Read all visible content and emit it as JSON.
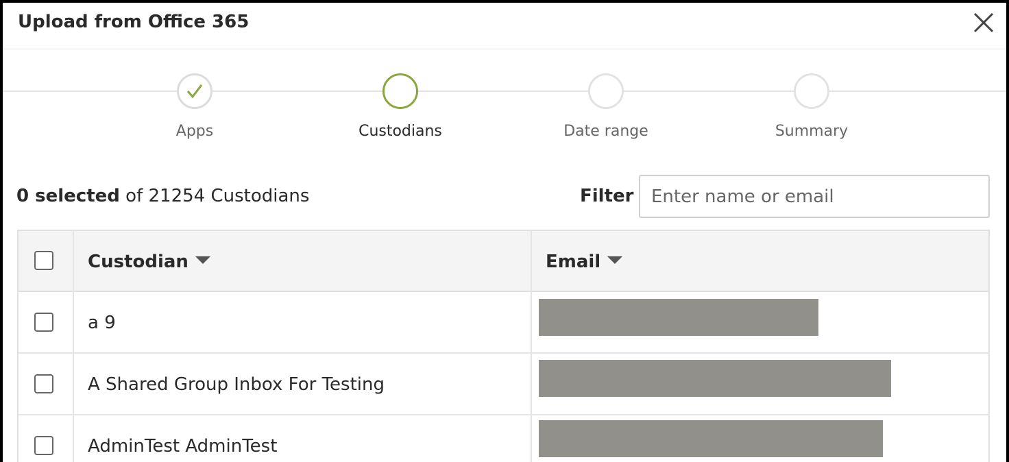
{
  "dialog": {
    "title": "Upload from Office 365",
    "close_icon": "close-icon"
  },
  "steps": [
    {
      "label": "Apps",
      "state": "done"
    },
    {
      "label": "Custodians",
      "state": "active"
    },
    {
      "label": "Date range",
      "state": "pending"
    },
    {
      "label": "Summary",
      "state": "pending"
    }
  ],
  "selection": {
    "selected_text": "0 selected",
    "of_text": "of 21254 Custodians"
  },
  "filter": {
    "label": "Filter",
    "placeholder": "Enter name or email",
    "value": ""
  },
  "table": {
    "columns": [
      {
        "label": "Custodian",
        "sort_icon": "sort-caret-icon"
      },
      {
        "label": "Email",
        "sort_icon": "sort-caret-icon"
      }
    ],
    "rows": [
      {
        "custodian": "a 9",
        "email": "[redacted]",
        "checked": false
      },
      {
        "custodian": "A Shared Group Inbox For Testing",
        "email": "[redacted]",
        "checked": false
      },
      {
        "custodian": "AdminTest AdminTest",
        "email": "[redacted]",
        "checked": false
      }
    ]
  },
  "colors": {
    "accent": "#8aa63f",
    "redaction": "#91908b"
  }
}
